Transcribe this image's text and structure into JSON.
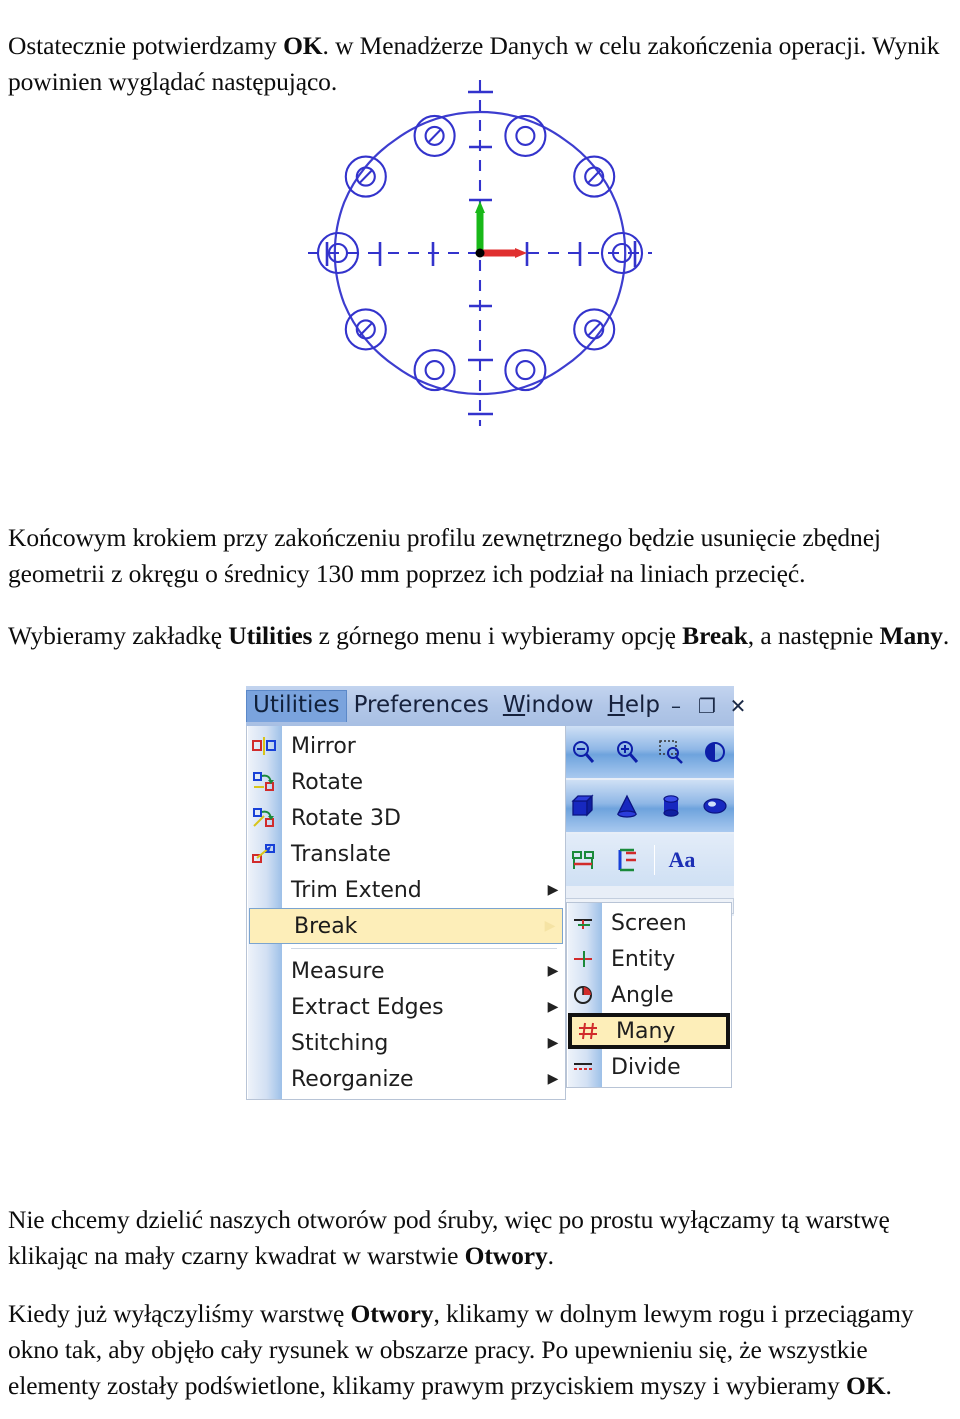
{
  "document": {
    "paragraphs": {
      "intro_prefix": "Ostatecznie potwierdzamy ",
      "intro_bold": "OK",
      "intro_suffix": ". w Menadżerze Danych w celu zakończenia operacji. Wynik powinien wyglądać następująco.",
      "final_step": "Końcowym krokiem przy zakończeniu profilu zewnętrznego będzie usunięcie zbędnej geometrii z okręgu o średnicy 130 mm poprzez ich podział na liniach przecięć.",
      "utilities_prefix": "Wybieramy zakładkę ",
      "utilities_bold1": "Utilities",
      "utilities_mid": " z górnego menu i wybieramy opcję ",
      "utilities_bold2": "Break",
      "utilities_suffix": ", a następnie ",
      "utilities_bold3": "Many",
      "utilities_end": ".",
      "layers_prefix": "Nie chcemy dzielić naszych otworów pod śruby, więc po prostu wyłączamy tą warstwę klikając na mały czarny kwadrat w warstwie ",
      "layers_bold": "Otwory",
      "layers_suffix": ".",
      "select_prefix": "Kiedy już wyłączyliśmy warstwę ",
      "select_bold1": "Otwory",
      "select_mid": ", klikamy w dolnym lewym rogu i przeciągamy okno tak, aby objęło cały rysunek w obszarze pracy. Po upewnieniu się, że wszystkie elementy zostały podświetlone, klikamy prawym przyciskiem myszy i wybieramy ",
      "select_bold2": "OK",
      "select_end": "."
    }
  },
  "cad_figure": {
    "name": "flange-sketch",
    "description": "Szkic CAD kołnierza z otworami na obwodzie i liniami osiowymi",
    "colors": {
      "geometry": "#3333cc",
      "centerline": "#3333cc",
      "axis_x": "#e03030",
      "axis_y": "#18b818",
      "origin": "#000000"
    },
    "hole_count": 10,
    "diameter_mm": 130
  },
  "menu_screenshot": {
    "menubar": {
      "items": [
        {
          "label": "Utilities",
          "active": true,
          "mnemonic": ""
        },
        {
          "label": "Preferences",
          "active": false,
          "mnemonic": ""
        },
        {
          "label": "Window",
          "active": false,
          "mnemonic": "W"
        },
        {
          "label": "Help",
          "active": false,
          "mnemonic": "H"
        }
      ],
      "window_controls": [
        {
          "name": "minimize-button",
          "glyph": "–"
        },
        {
          "name": "restore-button",
          "glyph": "❐"
        },
        {
          "name": "close-button",
          "glyph": "✕"
        }
      ]
    },
    "dropdown": {
      "items": [
        {
          "label": "Mirror",
          "icon": "mirror-icon",
          "submenu": false,
          "selected": false,
          "separator_after": false
        },
        {
          "label": "Rotate",
          "icon": "rotate-icon",
          "submenu": false,
          "selected": false,
          "separator_after": false
        },
        {
          "label": "Rotate 3D",
          "icon": "rotate-3d-icon",
          "submenu": false,
          "selected": false,
          "separator_after": false
        },
        {
          "label": "Translate",
          "icon": "translate-icon",
          "submenu": false,
          "selected": false,
          "separator_after": false
        },
        {
          "label": "Trim Extend",
          "icon": "none",
          "submenu": true,
          "selected": false,
          "separator_after": false
        },
        {
          "label": "Break",
          "icon": "none",
          "submenu": true,
          "selected": true,
          "separator_after": true
        },
        {
          "label": "Measure",
          "icon": "none",
          "submenu": true,
          "selected": false,
          "separator_after": false
        },
        {
          "label": "Extract Edges",
          "icon": "none",
          "submenu": true,
          "selected": false,
          "separator_after": false
        },
        {
          "label": "Stitching",
          "icon": "none",
          "submenu": true,
          "selected": false,
          "separator_after": false
        },
        {
          "label": "Reorganize",
          "icon": "none",
          "submenu": true,
          "selected": false,
          "separator_after": false
        }
      ]
    },
    "submenu": {
      "parent": "Break",
      "items": [
        {
          "label": "Screen",
          "icon": "break-screen-icon",
          "highlighted": false
        },
        {
          "label": "Entity",
          "icon": "break-entity-icon",
          "highlighted": false
        },
        {
          "label": "Angle",
          "icon": "break-angle-icon",
          "highlighted": false
        },
        {
          "label": "Many",
          "icon": "break-many-icon",
          "highlighted": true
        },
        {
          "label": "Divide",
          "icon": "break-divide-icon",
          "highlighted": false
        }
      ]
    },
    "toolbar": {
      "rows": [
        {
          "icons": [
            "zoom-out-icon",
            "zoom-in-icon",
            "zoom-area-icon",
            "rotate-view-icon"
          ]
        },
        {
          "icons": [
            "box-primitive-icon",
            "cone-primitive-icon",
            "cylinder-primitive-icon",
            "sphere-primitive-icon"
          ]
        },
        {
          "icons": [
            "datum-plane-icon",
            "datum-axis-icon",
            "text-annotation-icon"
          ],
          "text_icon_label": "Aa"
        }
      ]
    },
    "colors": {
      "menubar_bg": "#b2c7e8",
      "menubar_active": "#7aa3dd",
      "highlight_bg": "#fdeeb9",
      "highlight_border": "#7ba4cf",
      "box_border": "#111111",
      "gutter_blue": "#9dc0e8",
      "icon_blue": "#0d1ea8"
    }
  }
}
